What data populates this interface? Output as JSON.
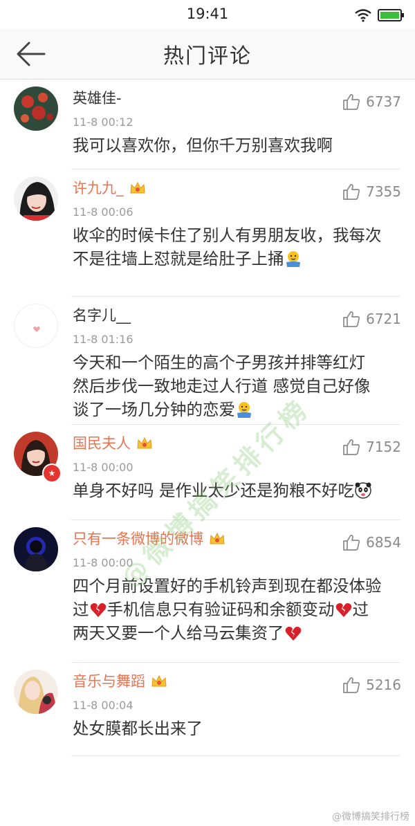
{
  "status_bar": {
    "time": "19:41"
  },
  "nav": {
    "title": "热门评论"
  },
  "comments": [
    {
      "name": "英雄佳-",
      "vip": false,
      "time": "11-8 00:12",
      "likes": "6737",
      "lines": [
        "我可以喜欢你，但你千万别喜欢我啊"
      ],
      "emojis": []
    },
    {
      "name": "许九九_",
      "vip": true,
      "time": "11-8 00:06",
      "likes": "7355",
      "lines": [
        "收伞的时候卡住了别人有男朋友收，我每次",
        "不是往墙上怼就是给肚子上捅"
      ],
      "emojis": [
        "shrug-emoji"
      ]
    },
    {
      "name": "名字儿__",
      "vip": false,
      "time": "11-8 01:16",
      "likes": "6721",
      "lines": [
        "今天和一个陌生的高个子男孩并排等红灯",
        "然后步伐一致地走过人行道 感觉自己好像",
        "谈了一场几分钟的恋爱"
      ],
      "emojis": [
        "shrug-emoji"
      ]
    },
    {
      "name": "国民夫人",
      "vip": true,
      "time": "11-8 00:00",
      "likes": "7152",
      "lines": [
        "单身不好吗 是作业太少还是狗粮不好吃"
      ],
      "emojis": [
        "panda-emoji"
      ]
    },
    {
      "name": "只有一条微博的微博",
      "vip": true,
      "time": "11-8 00:00",
      "likes": "6854",
      "lines": [
        "四个月前设置好的手机铃声到现在都没体验",
        "过",
        "手机信息只有验证码和余额变动",
        "过",
        "两天又要一个人给马云集资了"
      ],
      "emojis": [
        "broken-heart-emoji"
      ]
    },
    {
      "name": "音乐与舞蹈",
      "vip": true,
      "time": "11-8 00:04",
      "likes": "5216",
      "lines": [
        "处女膜都长出来了"
      ],
      "emojis": []
    }
  ],
  "watermark": "@微博搞笑排行榜",
  "footer_watermark": "@微博搞笑排行榜",
  "colors": {
    "vip_name": "#eb7350",
    "text": "#333333",
    "meta": "#9a9a9a",
    "divider": "#e6e6e6",
    "nav_bg": "#f9f9f9"
  },
  "icons": [
    "back-arrow-icon",
    "wifi-icon",
    "battery-icon",
    "thumbs-up-icon",
    "vip-crown-icon"
  ]
}
